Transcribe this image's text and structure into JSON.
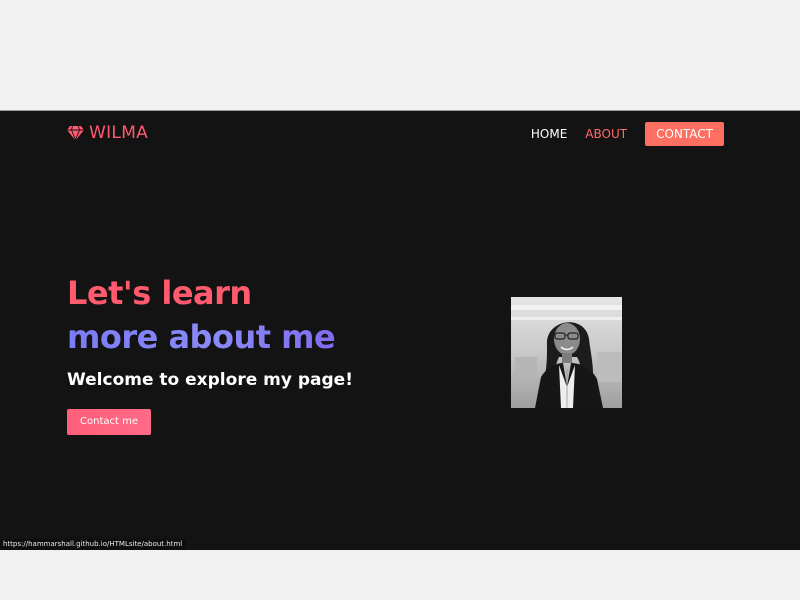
{
  "nav": {
    "brand": "WILMA",
    "links": [
      {
        "label": "HOME",
        "state": "default"
      },
      {
        "label": "ABOUT",
        "state": "active"
      }
    ],
    "contact_label": "CONTACT"
  },
  "hero": {
    "line1": "Let's learn",
    "line2": "more about me",
    "subtitle": "Welcome to explore my page!",
    "button_label": "Contact me"
  },
  "portrait": {
    "alt": "portrait photo"
  },
  "status": {
    "url": "https://hammarshall.github.io/HTMLsite/about.html"
  },
  "colors": {
    "background": "#141314",
    "brand": "#ff5a6e",
    "accent_button": "#ff6f61",
    "gradient_text": "#7b7cf6"
  },
  "icons": {
    "brand": "diamond-icon"
  }
}
